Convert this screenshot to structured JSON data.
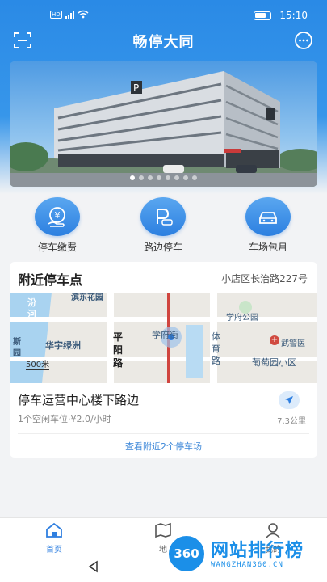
{
  "status_bar": {
    "network": "HD",
    "time": "15:10"
  },
  "header": {
    "title": "畅停大同",
    "left_icon": "scan-icon",
    "right_icon": "chat-icon"
  },
  "banner": {
    "dot_count": 8,
    "active_dot": 0
  },
  "quick_actions": [
    {
      "label": "停车缴费",
      "icon": "yuan-payment-icon"
    },
    {
      "label": "路边停车",
      "icon": "roadside-parking-icon"
    },
    {
      "label": "车场包月",
      "icon": "car-icon"
    }
  ],
  "nearby": {
    "title": "附近停车点",
    "address": "小店区长治路227号",
    "map": {
      "labels": [
        "汾",
        "河",
        "滨东花园",
        "学府公园",
        "华宇绿洲",
        "平",
        "阳",
        "路",
        "学府街",
        "体",
        "育",
        "路",
        "武警医",
        "葡萄园小区",
        "斯",
        "园"
      ],
      "scale": "500米"
    },
    "lot": {
      "name": "停车运营中心楼下路边",
      "info": "1个空闲车位·¥2.0/小时",
      "distance": "7.3公里"
    },
    "view_more": "查看附近2个停车场"
  },
  "tabbar": {
    "tabs": [
      {
        "label": "首页",
        "icon": "home-icon",
        "active": true
      },
      {
        "label": "地",
        "icon": "map-icon",
        "active": false
      },
      {
        "label": "我的",
        "icon": "user-icon",
        "active": false
      }
    ]
  },
  "watermark": {
    "badge": "360",
    "text": "网站排行榜",
    "url": "WANGZHAN360.CN"
  },
  "colors": {
    "primary": "#2f7fe0",
    "header_bg": "#2a8ae6"
  }
}
